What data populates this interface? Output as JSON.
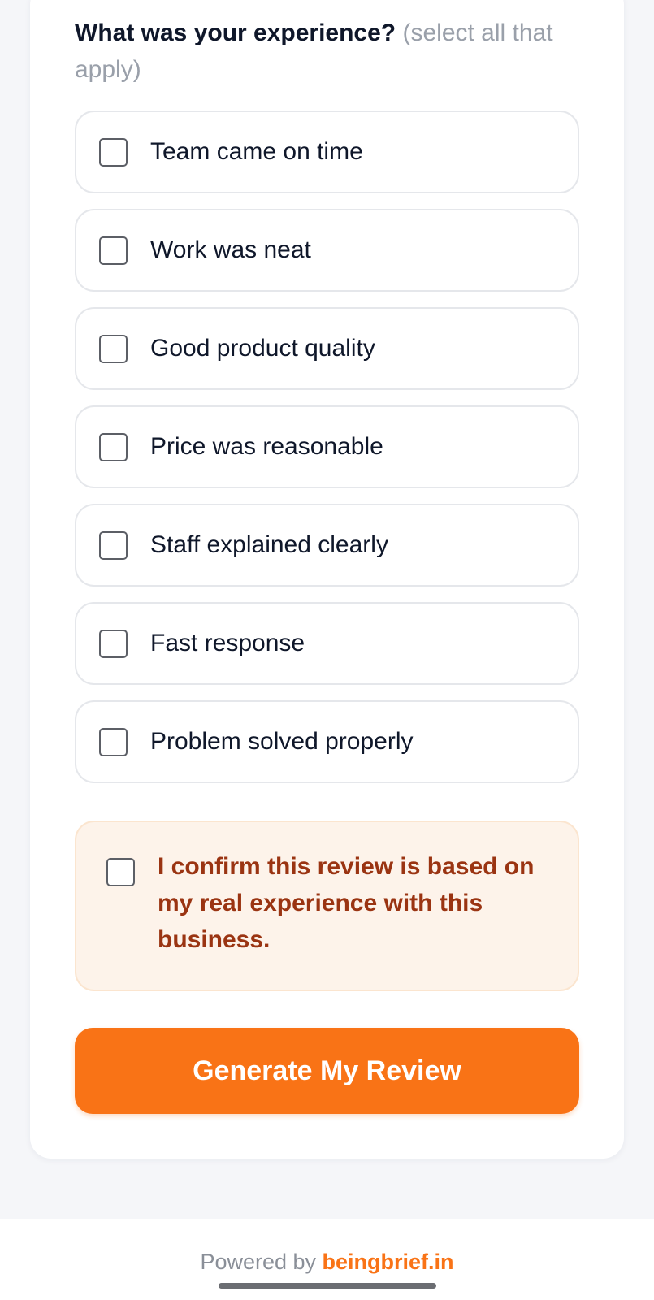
{
  "question": {
    "title": "What was your experience?",
    "hint": "(select all that apply)"
  },
  "options": [
    {
      "label": "Team came on time",
      "checked": false
    },
    {
      "label": "Work was neat",
      "checked": false
    },
    {
      "label": "Good product quality",
      "checked": false
    },
    {
      "label": "Price was reasonable",
      "checked": false
    },
    {
      "label": "Staff explained clearly",
      "checked": false
    },
    {
      "label": "Fast response",
      "checked": false
    },
    {
      "label": "Problem solved properly",
      "checked": false
    }
  ],
  "confirm": {
    "label": "I confirm this review is based on my real experience with this business.",
    "checked": false
  },
  "generate_button": {
    "label": "Generate My Review"
  },
  "footer": {
    "prefix": "Powered by",
    "brand": "beingbrief.in"
  },
  "colors": {
    "accent": "#f97316",
    "confirm_text": "#9a3412",
    "confirm_bg": "#fdf3ea",
    "text_primary": "#0f172a",
    "text_muted": "#9aa0aa"
  }
}
